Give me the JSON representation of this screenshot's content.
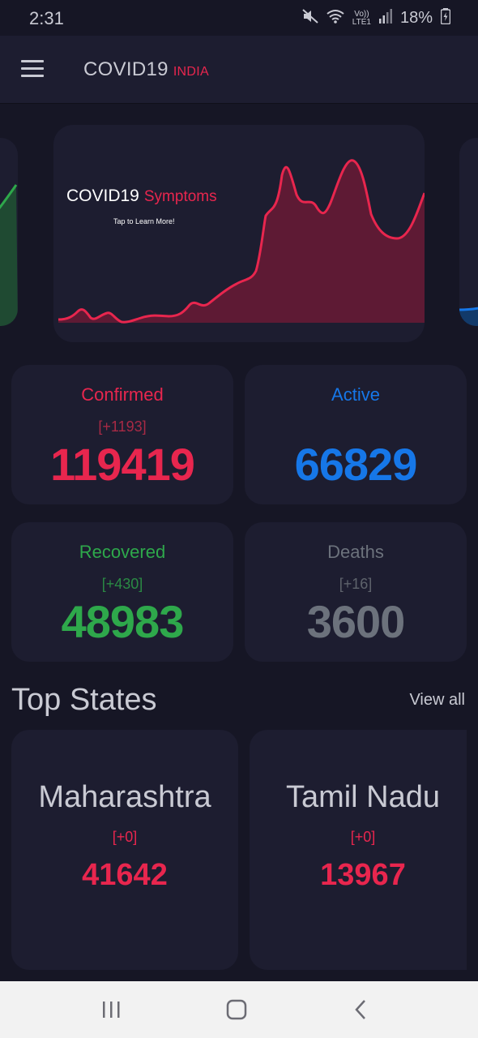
{
  "status": {
    "time": "2:31",
    "mute_icon": "mute-icon",
    "wifi_icon": "wifi-icon",
    "lte_top": "Vo))",
    "lte_bottom": "LTE1",
    "signal_icon": "signal-icon",
    "battery": "18%",
    "battery_icon": "battery-icon"
  },
  "app_bar": {
    "title": "COVID19",
    "subtitle": "INDIA",
    "menu_icon": "hamburger-menu-icon"
  },
  "carousel": {
    "title": "COVID19",
    "title_accent": "Symptoms",
    "tagline": "Tap to Learn More!"
  },
  "stats": {
    "confirmed": {
      "label": "Confirmed",
      "delta": "[+1193]",
      "value": "119419",
      "color": "#e8264e"
    },
    "active": {
      "label": "Active",
      "delta": "",
      "value": "66829",
      "color": "#1677e8"
    },
    "recovered": {
      "label": "Recovered",
      "delta": "[+430]",
      "value": "48983",
      "color": "#2ea84b"
    },
    "deaths": {
      "label": "Deaths",
      "delta": "[+16]",
      "value": "3600",
      "color": "#6c727c"
    }
  },
  "top_states": {
    "title": "Top States",
    "view_all": "View all",
    "items": [
      {
        "name": "Maharashtra",
        "delta": "[+0]",
        "value": "41642"
      },
      {
        "name": "Tamil Nadu",
        "delta": "[+0]",
        "value": "13967"
      }
    ]
  },
  "nav": {
    "recents_icon": "recents-icon",
    "home_icon": "home-icon",
    "back_icon": "back-icon"
  }
}
